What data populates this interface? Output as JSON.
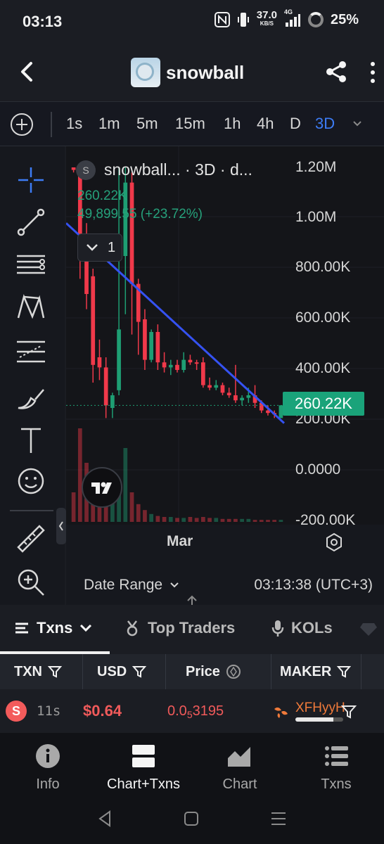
{
  "status": {
    "time": "03:13",
    "net_speed": "37.0",
    "net_unit": "KB/S",
    "net_type": "4G",
    "battery": "25%"
  },
  "header": {
    "title": "snowball",
    "back_icon": "back-arrow-icon",
    "share_icon": "share-icon",
    "more_icon": "more-vertical-icon"
  },
  "intervals": {
    "items": [
      "1s",
      "1m",
      "5m",
      "15m",
      "1h",
      "4h",
      "D",
      "3D"
    ],
    "active": "3D"
  },
  "chart": {
    "legend_symbol": "S",
    "legend_title": "snowball... · 3D · d...",
    "legend_price": "260.22K",
    "legend_change": "49,899.55 (+23.72%)",
    "collapse_count": "1",
    "last_price_tag": "260.22K",
    "month_label": "Mar",
    "date_range_label": "Date Range",
    "clock": "03:13:38 (UTC+3)"
  },
  "chart_data": {
    "type": "candlestick",
    "interval": "3D",
    "y_axis_labels": [
      "1.20M",
      "1.00M",
      "800.00K",
      "600.00K",
      "400.00K",
      "200.00K",
      "0.0000",
      "-200.00K"
    ],
    "ylim": [
      -200000,
      1200000
    ],
    "x_axis_labels": [
      "Mar"
    ],
    "last_price": 260220,
    "trendline": true,
    "candles": [
      {
        "o": 1200000,
        "h": 1200000,
        "l": 1180000,
        "c": 1190000
      },
      {
        "o": 1200000,
        "h": 1210000,
        "l": 760000,
        "c": 900000
      },
      {
        "o": 900000,
        "h": 980000,
        "l": 640000,
        "c": 700000
      },
      {
        "o": 770000,
        "h": 800000,
        "l": 350000,
        "c": 420000
      },
      {
        "o": 450000,
        "h": 520000,
        "l": 360000,
        "c": 410000
      },
      {
        "o": 410000,
        "h": 450000,
        "l": 210000,
        "c": 260000
      },
      {
        "o": 250000,
        "h": 310000,
        "l": 210000,
        "c": 300000
      },
      {
        "o": 320000,
        "h": 1200000,
        "l": 300000,
        "c": 560000
      },
      {
        "o": 850000,
        "h": 1200000,
        "l": 620000,
        "c": 1140000
      },
      {
        "o": 1140000,
        "h": 1180000,
        "l": 540000,
        "c": 740000
      },
      {
        "o": 740000,
        "h": 760000,
        "l": 460000,
        "c": 590000
      },
      {
        "o": 600000,
        "h": 640000,
        "l": 400000,
        "c": 440000
      },
      {
        "o": 440000,
        "h": 560000,
        "l": 430000,
        "c": 550000
      },
      {
        "o": 550000,
        "h": 580000,
        "l": 400000,
        "c": 430000
      },
      {
        "o": 430000,
        "h": 470000,
        "l": 390000,
        "c": 410000
      },
      {
        "o": 410000,
        "h": 440000,
        "l": 380000,
        "c": 420000
      },
      {
        "o": 420000,
        "h": 440000,
        "l": 390000,
        "c": 400000
      },
      {
        "o": 400000,
        "h": 470000,
        "l": 390000,
        "c": 440000
      },
      {
        "o": 440000,
        "h": 460000,
        "l": 420000,
        "c": 430000
      },
      {
        "o": 430000,
        "h": 440000,
        "l": 400000,
        "c": 425000
      },
      {
        "o": 430000,
        "h": 450000,
        "l": 330000,
        "c": 340000
      },
      {
        "o": 340000,
        "h": 370000,
        "l": 320000,
        "c": 330000
      },
      {
        "o": 330000,
        "h": 360000,
        "l": 320000,
        "c": 340000
      },
      {
        "o": 340000,
        "h": 350000,
        "l": 300000,
        "c": 310000
      },
      {
        "o": 310000,
        "h": 330000,
        "l": 290000,
        "c": 300000
      },
      {
        "o": 300000,
        "h": 420000,
        "l": 270000,
        "c": 280000
      },
      {
        "o": 280000,
        "h": 300000,
        "l": 260000,
        "c": 290000
      },
      {
        "o": 290000,
        "h": 330000,
        "l": 270000,
        "c": 300000
      },
      {
        "o": 300000,
        "h": 340000,
        "l": 250000,
        "c": 270000
      },
      {
        "o": 270000,
        "h": 280000,
        "l": 230000,
        "c": 240000
      },
      {
        "o": 240000,
        "h": 260000,
        "l": 220000,
        "c": 230000
      },
      {
        "o": 230000,
        "h": 240000,
        "l": 210000,
        "c": 225000
      },
      {
        "o": 210000,
        "h": 260000,
        "l": 210000,
        "c": 260220
      }
    ],
    "volumes": [
      0.3,
      0.95,
      0.6,
      0.4,
      0.25,
      0.35,
      0.2,
      0.4,
      0.75,
      0.3,
      0.18,
      0.12,
      0.08,
      0.06,
      0.05,
      0.05,
      0.04,
      0.04,
      0.05,
      0.04,
      0.05,
      0.04,
      0.04,
      0.03,
      0.03,
      0.03,
      0.03,
      0.03,
      0.02,
      0.02,
      0.02,
      0.02,
      0.02
    ]
  },
  "tabs": [
    {
      "label": "Txns",
      "active": true
    },
    {
      "label": "Top Traders",
      "active": false
    },
    {
      "label": "KOLs",
      "active": false
    }
  ],
  "table": {
    "headers": [
      "TXN",
      "USD",
      "Price",
      "MAKER"
    ],
    "row": {
      "side": "S",
      "age": "11s",
      "usd": "$0.64",
      "price_prefix": "0.0",
      "price_sub": "5",
      "price_digits": "3195",
      "maker": "XFHyyH",
      "maker_bar": 0.8
    }
  },
  "bottom_nav": [
    {
      "label": "Info",
      "icon": "info-icon",
      "active": false
    },
    {
      "label": "Chart+Txns",
      "icon": "chart-txns-icon",
      "active": true
    },
    {
      "label": "Chart",
      "icon": "chart-icon",
      "active": false
    },
    {
      "label": "Txns",
      "icon": "list-icon",
      "active": false
    }
  ],
  "colors": {
    "up": "#1e9e73",
    "down": "#f0394a",
    "trendline": "#3552f2",
    "accent": "#3d7cf5"
  }
}
